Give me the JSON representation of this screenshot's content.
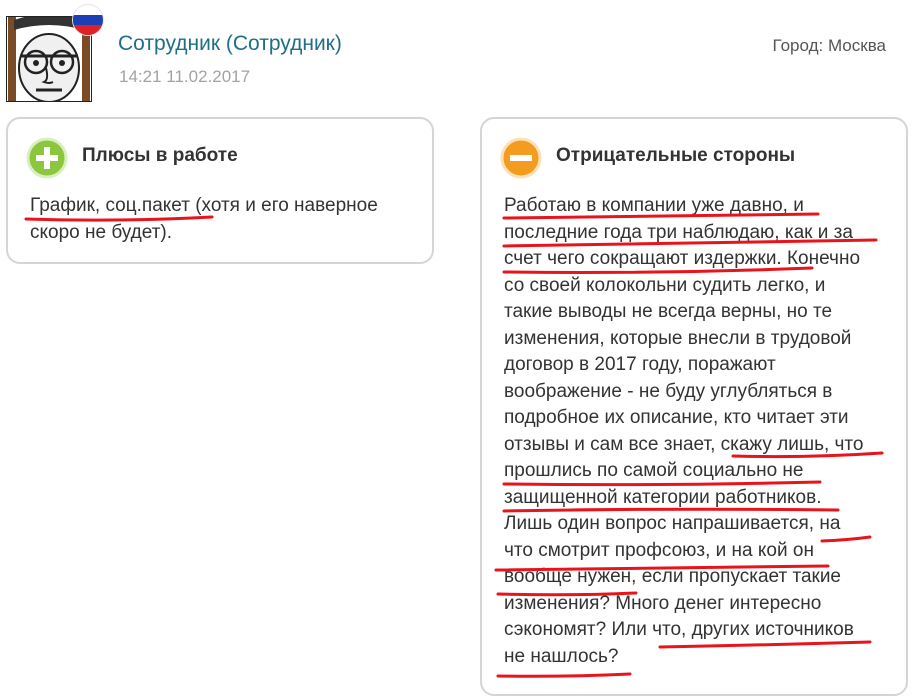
{
  "review": {
    "author": "Сотрудник (Сотрудник)",
    "date": "14:21 11.02.2017",
    "city": "Город: Москва"
  },
  "pros": {
    "title": "Плюсы в работе",
    "icon": "plus-circle-icon",
    "icon_color": "#8cc63f",
    "lines": [
      "График, соц.пакет (хотя и его наверное",
      "скоро не будет)."
    ]
  },
  "cons": {
    "title": "Отрицательные стороны",
    "icon": "minus-circle-icon",
    "icon_color": "#f39c1f",
    "lines": [
      "Работаю в компании уже давно, и",
      "последние года три наблюдаю, как и за",
      "счет чего сокращают издержки. Конечно",
      "со своей колокольни судить легко, и",
      "такие выводы не всегда верны, но те",
      "изменения, которые внесли в трудовой",
      "договор в 2017 году, поражают",
      "воображение - не буду углубляться в",
      "подробное их описание, кто читает эти",
      "отзывы и сам все знает, скажу лишь, что",
      "прошлись по самой социально не",
      "защищенной категории работников.",
      "Лишь один вопрос напрашивается, на",
      "что смотрит профсоюз, и на кой он",
      "вообще нужен, если пропускает такие",
      "изменения? Много денег интересно",
      "сэкономят? Или что, других источников",
      "не нашлось?"
    ]
  },
  "colors": {
    "author_link": "#1f6f86",
    "underline_marker": "#e8141c",
    "card_border": "#d5d5d5"
  }
}
